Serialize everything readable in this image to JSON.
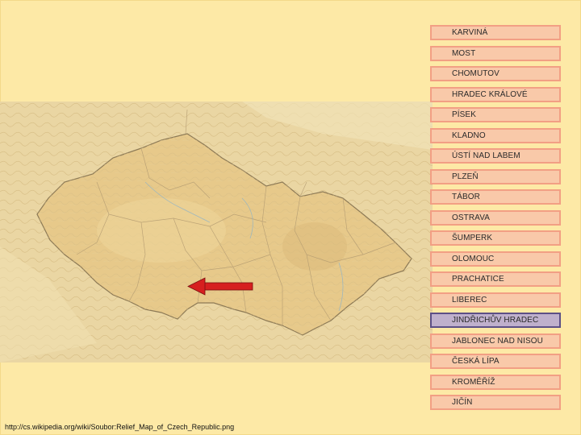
{
  "cities": [
    {
      "label": "KARVINÁ",
      "selected": false
    },
    {
      "label": "MOST",
      "selected": false
    },
    {
      "label": "CHOMUTOV",
      "selected": false
    },
    {
      "label": "HRADEC KRÁLOVÉ",
      "selected": false
    },
    {
      "label": "PÍSEK",
      "selected": false
    },
    {
      "label": "KLADNO",
      "selected": false
    },
    {
      "label": "ÚSTÍ NAD LABEM",
      "selected": false
    },
    {
      "label": "PLZEŇ",
      "selected": false
    },
    {
      "label": "TÁBOR",
      "selected": false
    },
    {
      "label": "OSTRAVA",
      "selected": false
    },
    {
      "label": "ŠUMPERK",
      "selected": false
    },
    {
      "label": "OLOMOUC",
      "selected": false
    },
    {
      "label": "PRACHATICE",
      "selected": false
    },
    {
      "label": "LIBEREC",
      "selected": false
    },
    {
      "label": "JINDŘICHŮV HRADEC",
      "selected": true
    },
    {
      "label": "JABLONEC NAD NISOU",
      "selected": false
    },
    {
      "label": "ČESKÁ LÍPA",
      "selected": false
    },
    {
      "label": "KROMĚŘÍŽ",
      "selected": false
    },
    {
      "label": "JIČÍN",
      "selected": false
    }
  ],
  "source": {
    "url": "http://cs.wikipedia.org/wiki/Soubor:Relief_Map_of_Czech_Republic.png"
  },
  "colors": {
    "background": "#fde9a6",
    "item_fill": "#f9c9a9",
    "item_border": "#f29f84",
    "selected_fill": "#bfb0cc",
    "selected_border": "#5c4f86",
    "arrow": "#d61f1f"
  },
  "map": {
    "icon": "relief-map-czech-republic",
    "pointer": "red-arrow-left"
  }
}
